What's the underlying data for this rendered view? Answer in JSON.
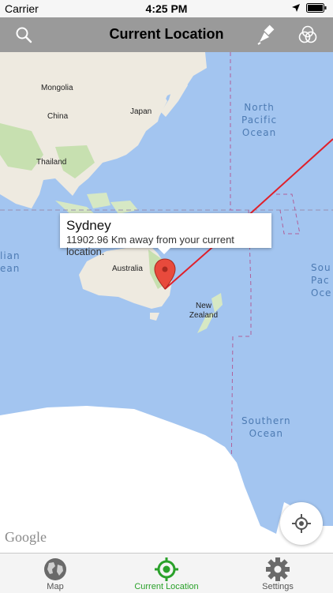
{
  "status_bar": {
    "carrier": "Carrier",
    "time": "4:25 PM"
  },
  "nav": {
    "title": "Current Location",
    "left_icon": "search-icon",
    "right_icons": [
      "brush-icon",
      "color-circles-icon"
    ]
  },
  "map": {
    "countries": [
      "Mongolia",
      "China",
      "Japan",
      "Thailand",
      "Australia",
      "New Zealand"
    ],
    "oceans": {
      "north_pacific": "North\nPacific\nOcean",
      "south_pacific_partial": "Sou\nPac\nOce",
      "indian_partial": "lian\nean",
      "southern": "Southern\nOcean"
    },
    "attribution": "Google"
  },
  "callout": {
    "name": "Sydney",
    "distance": "11902.96 Km away from your current location."
  },
  "tabs": [
    {
      "label": "Map",
      "icon": "globe-icon",
      "active": false
    },
    {
      "label": "Current Location",
      "icon": "target-icon",
      "active": true
    },
    {
      "label": "Settings",
      "icon": "gear-icon",
      "active": false
    }
  ],
  "colors": {
    "accent": "#2aa12a",
    "route": "#e0202a",
    "water": "#a3c5f0",
    "land": "#eeeae0",
    "ice": "#ffffff"
  }
}
